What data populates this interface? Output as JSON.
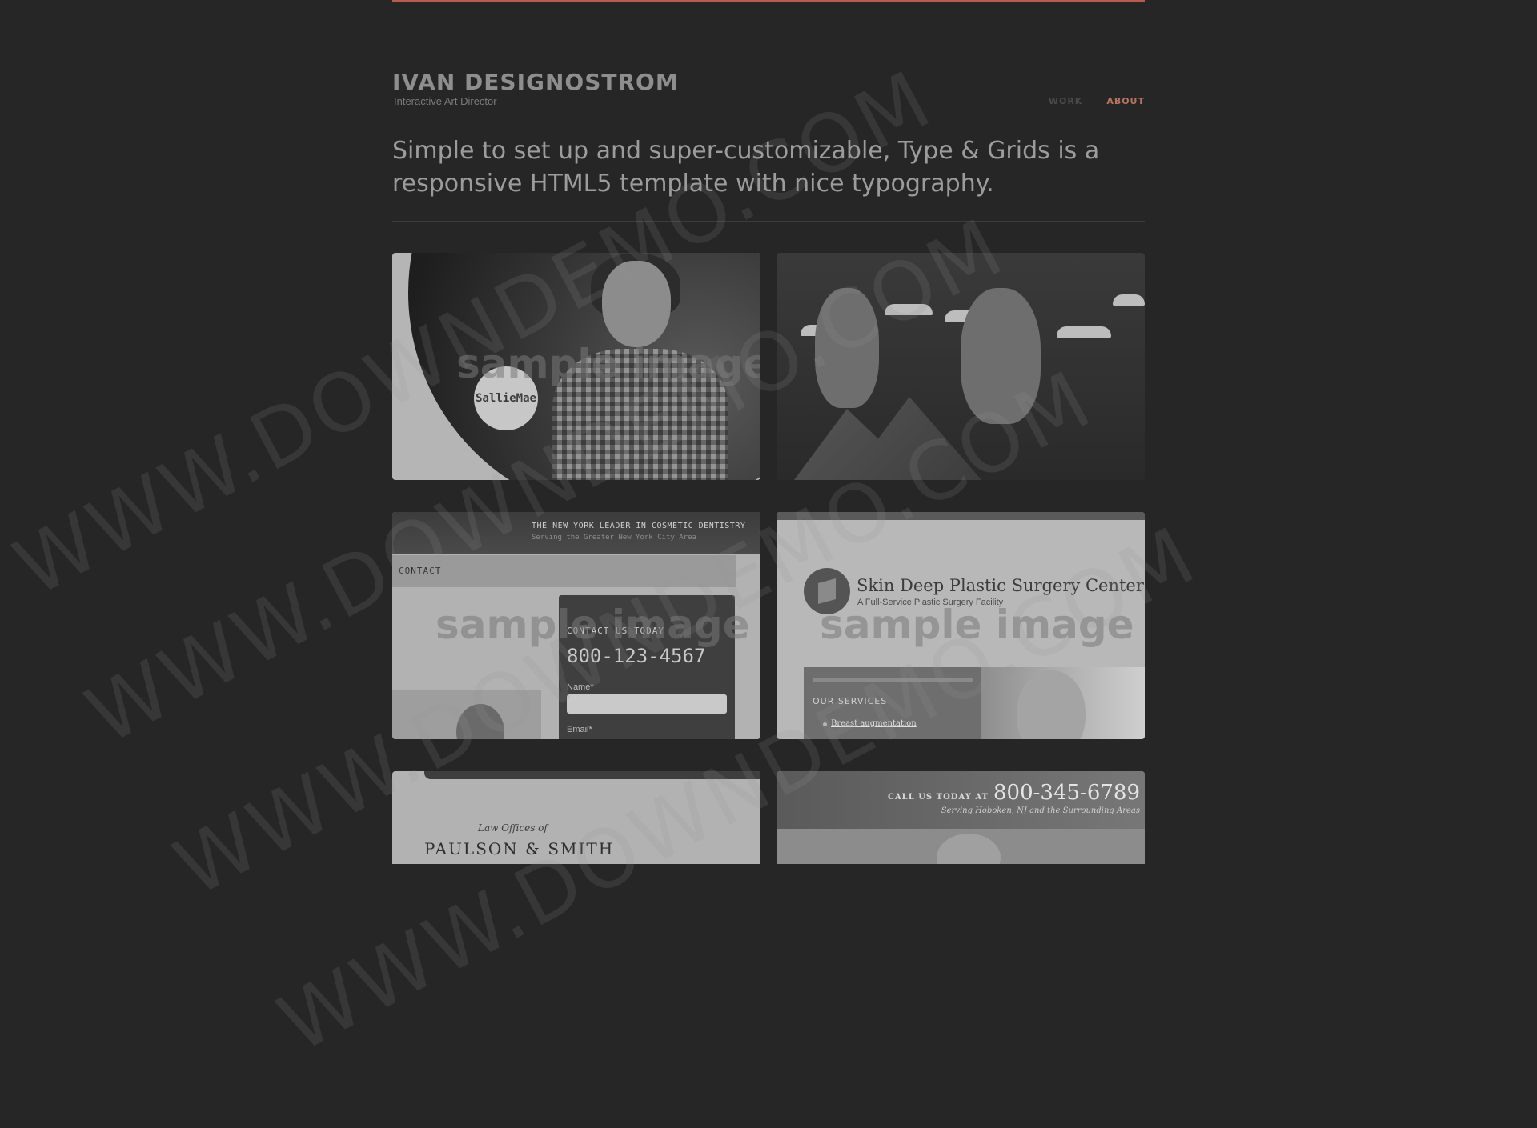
{
  "colors": {
    "background": "#262626",
    "accent": "#b85a4e",
    "active_nav": "#b7745f"
  },
  "header": {
    "name": "IVAN DESIGNOSTROM",
    "tagline": "Interactive Art Director"
  },
  "nav": {
    "items": [
      {
        "label": "WORK",
        "active": false
      },
      {
        "label": "ABOUT",
        "active": true
      }
    ]
  },
  "intro": {
    "text": "Simple to set up and super-customizable, Type & Grids is a responsive HTML5 template with nice typography."
  },
  "sample_label": "sample image",
  "portfolio": {
    "tile1": {
      "logo": "SallieMae"
    },
    "tile3": {
      "headline": "THE NEW YORK LEADER IN COSMETIC DENTISTRY",
      "subline": "Serving the Greater New York City Area",
      "nav_label": "CONTACT",
      "form_title": "CONTACT US TODAY",
      "phone": "800-123-4567",
      "name_label": "Name*",
      "email_label": "Email*"
    },
    "tile4": {
      "title": "Skin Deep Plastic Surgery Center",
      "subtitle": "A Full-Service Plastic Surgery Facility",
      "services_title": "OUR SERVICES",
      "service_item": "Breast augmentation"
    },
    "tile5": {
      "kicker": "Law Offices of",
      "firm": "PAULSON & SMITH"
    },
    "tile6": {
      "call_label": "CALL US TODAY AT",
      "phone": "800-345-6789",
      "sub": "Serving Hoboken, NJ and the Surrounding Areas"
    }
  },
  "watermark": "WWW.DOWNDEMO.COM"
}
